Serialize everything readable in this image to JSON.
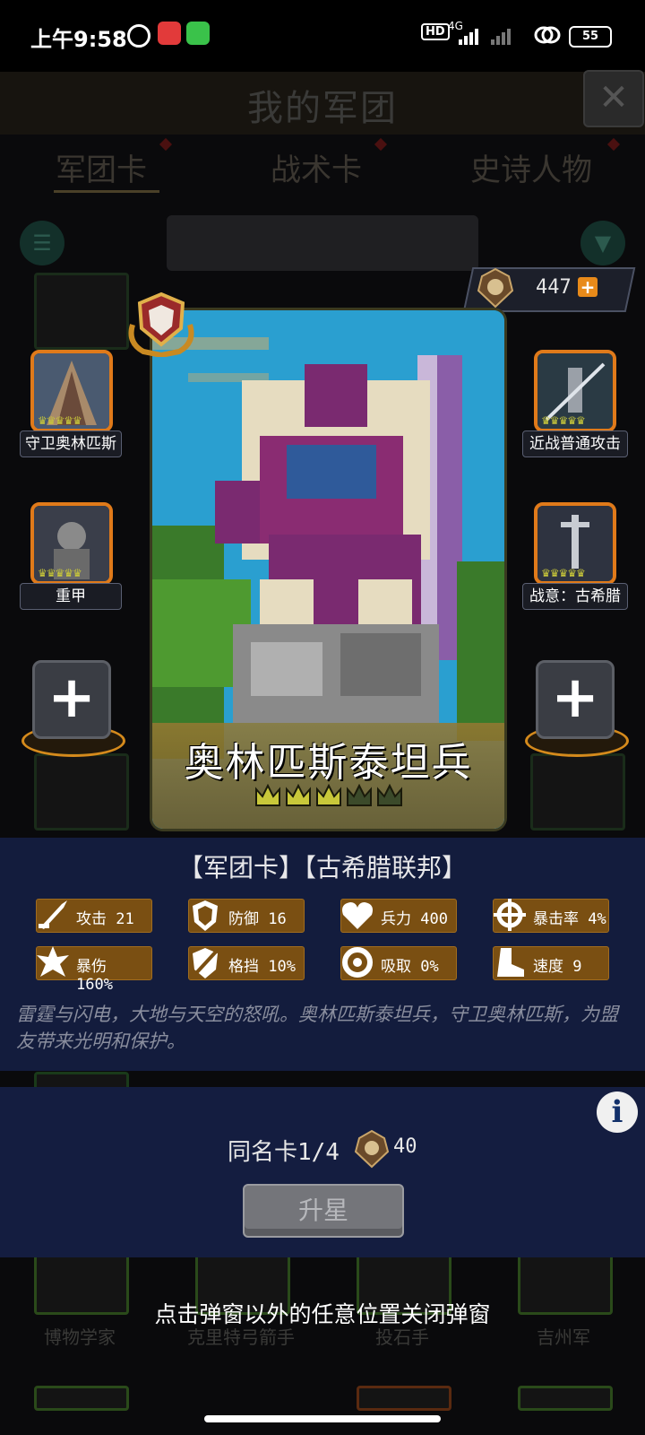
{
  "status_bar": {
    "time": "上午9:58",
    "network": "4G",
    "battery": "55",
    "hd": "HD"
  },
  "background": {
    "title": "我的军团",
    "tabs": [
      "军团卡",
      "战术卡",
      "史诗人物"
    ],
    "bottom_cards": [
      "博物学家",
      "克里特弓箭手",
      "投石手",
      "吉州军"
    ]
  },
  "currency": {
    "value": "447",
    "plus": "+"
  },
  "card": {
    "name": "奥林匹斯泰坦兵",
    "stars_filled": 3,
    "stars_total": 5
  },
  "left_slots": [
    {
      "label": "守卫奥林匹斯"
    },
    {
      "label": "重甲"
    }
  ],
  "right_slots": [
    {
      "label": "近战普通攻击"
    },
    {
      "label": "战意：古希腊"
    }
  ],
  "add_slot_symbol": "+",
  "faction": "【军团卡】【古希腊联邦】",
  "stats": [
    {
      "icon": "sword-icon",
      "text": "攻击 21"
    },
    {
      "icon": "shield-icon",
      "text": "防御 16"
    },
    {
      "icon": "heart-icon",
      "text": "兵力 400"
    },
    {
      "icon": "crosshair-icon",
      "text": "暴击率 4%"
    },
    {
      "icon": "burst-icon",
      "text": "暴伤 160%"
    },
    {
      "icon": "parry-shield-icon",
      "text": "格挡 10%"
    },
    {
      "icon": "absorb-icon",
      "text": "吸取 0%"
    },
    {
      "icon": "boot-icon",
      "text": "速度 9"
    }
  ],
  "description": "雷霆与闪电，大地与天空的怒吼。奥林匹斯泰坦兵，守卫奥林匹斯，为盟友带来光明和保护。",
  "upgrade": {
    "same_card": "同名卡1/4",
    "cost": "40",
    "button": "升星"
  },
  "info_symbol": "i",
  "hint": "点击弹窗以外的任意位置关闭弹窗",
  "colors": {
    "panel": "#131c3d",
    "stat_bg": "#7a4f12",
    "slot_border": "#e07a1a",
    "crown_filled": "#c9c83a",
    "crown_empty": "#3b4a2a"
  }
}
